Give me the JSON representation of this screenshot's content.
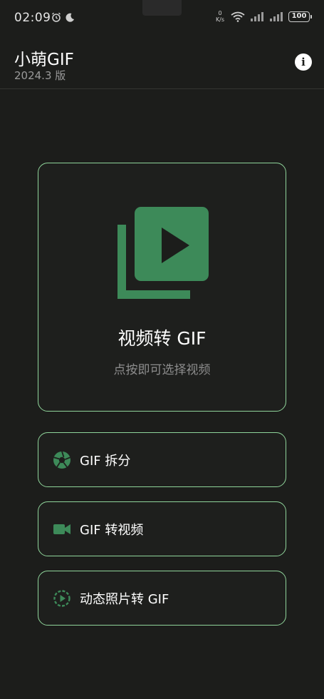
{
  "status_bar": {
    "time": "02:09",
    "net_speed_value": "0",
    "net_speed_unit": "K/s",
    "battery": "100"
  },
  "header": {
    "title": "小萌GIF",
    "version": "2024.3 版",
    "info_glyph": "i"
  },
  "main_card": {
    "title": "视频转 GIF",
    "subtitle": "点按即可选择视频",
    "icon": "video-library-icon"
  },
  "options": [
    {
      "label": "GIF 拆分",
      "icon": "shutter-icon"
    },
    {
      "label": "GIF 转视频",
      "icon": "videocam-icon"
    },
    {
      "label": "动态照片转 GIF",
      "icon": "live-photo-icon"
    }
  ],
  "colors": {
    "background": "#1c1d1b",
    "accent_border": "#8fd49a",
    "icon_green": "#3d8a59",
    "subtitle_gray": "#8d8d8d"
  }
}
